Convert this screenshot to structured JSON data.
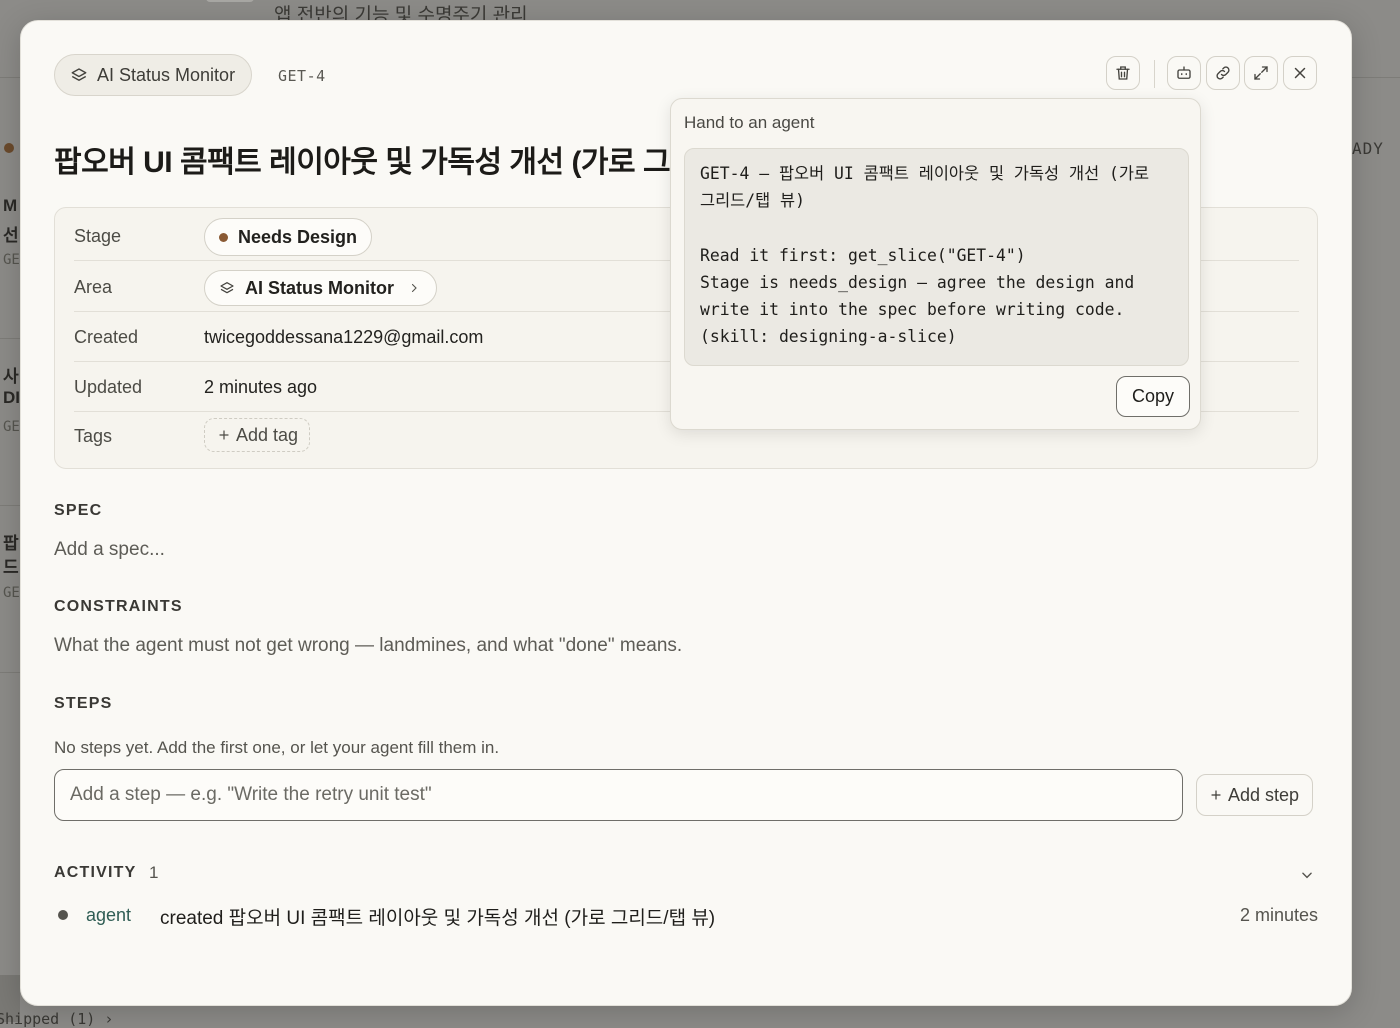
{
  "background": {
    "header_subtitle": "앱 전반의 기능 및 수명주기 관리",
    "column_status_partial": "ADY",
    "cards": [
      {
        "line1": "M",
        "line2": "선",
        "id": "GE"
      },
      {
        "line1": "사",
        "line2": "DI",
        "id": "GE"
      },
      {
        "line1": "팝",
        "line2": "드",
        "id": "GE"
      }
    ],
    "footer_partial": "Shipped (1) ›"
  },
  "modal": {
    "area_chip_label": "AI Status Monitor",
    "slice_id": "GET-4",
    "toolbar": {
      "delete_icon": "trash-icon",
      "agent_icon": "robot-icon",
      "link_icon": "link-icon",
      "expand_icon": "expand-icon",
      "close_icon": "close-icon"
    },
    "title": "팝오버 UI 콤팩트 레이아웃 및 가독성 개선 (가로 그리드/탭 뷰)",
    "properties": {
      "stage_label": "Stage",
      "stage_value": "Needs Design",
      "area_label": "Area",
      "area_value": "AI Status Monitor",
      "created_label": "Created",
      "created_value": "twicegoddessana1229@gmail.com",
      "updated_label": "Updated",
      "updated_value": "2 minutes ago",
      "tags_label": "Tags",
      "add_tag_label": "Add tag"
    },
    "spec": {
      "heading": "SPEC",
      "placeholder": "Add a spec..."
    },
    "constraints": {
      "heading": "CONSTRAINTS",
      "placeholder": "What the agent must not get wrong — landmines, and what \"done\" means."
    },
    "steps": {
      "heading": "STEPS",
      "empty_hint": "No steps yet. Add the first one, or let your agent fill them in.",
      "input_placeholder": "Add a step — e.g. \"Write the retry unit test\"",
      "add_button_label": "Add step"
    },
    "activity": {
      "heading": "ACTIVITY",
      "count": "1",
      "items": [
        {
          "actor": "agent",
          "text": "created 팝오버 UI 콤팩트 레이아웃 및 가독성 개선 (가로 그리드/탭 뷰)",
          "time": "2 minutes"
        }
      ]
    }
  },
  "popover": {
    "title": "Hand to an agent",
    "code": "GET-4 — 팝오버 UI 콤팩트 레이아웃 및 가독성 개선 (가로 그리드/탭 뷰)\n\nRead it first: get_slice(\"GET-4\")\nStage is needs_design — agree the design and write it into the spec before writing code. (skill: designing-a-slice)",
    "copy_label": "Copy"
  },
  "colors": {
    "stage_dot": "#8a5a34",
    "actor_link": "#2f5d54",
    "modal_bg": "#faf9f5",
    "overlay": "#8c8b88"
  }
}
